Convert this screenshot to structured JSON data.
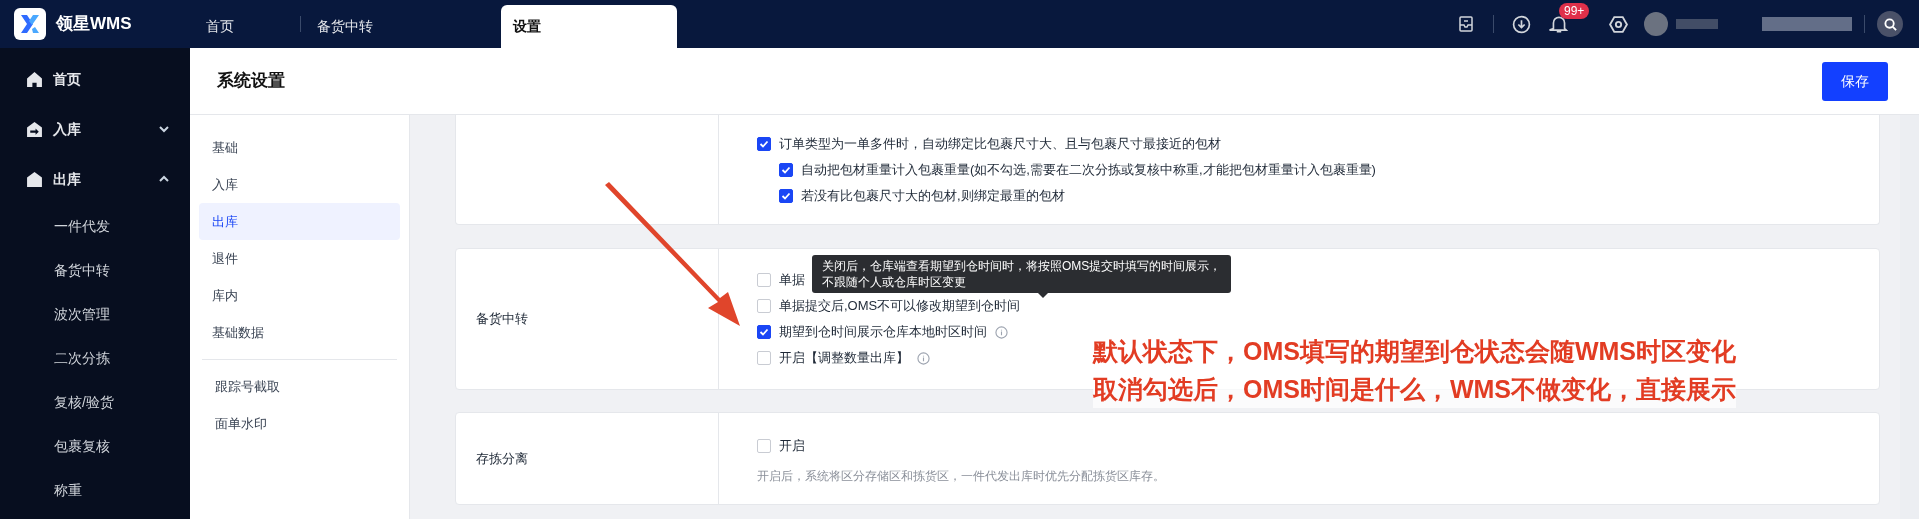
{
  "app": {
    "logo_text": "领星WMS"
  },
  "tabs": [
    {
      "label": "首页",
      "selected": false
    },
    {
      "label": "备货中转",
      "selected": false
    },
    {
      "label": "设置",
      "selected": true
    }
  ],
  "header": {
    "badge": "99+"
  },
  "sidebar": {
    "items": [
      {
        "label": "首页",
        "kind": "home"
      },
      {
        "label": "入库",
        "kind": "inbound",
        "expanded": false
      },
      {
        "label": "出库",
        "kind": "outbound",
        "expanded": true,
        "children": [
          {
            "label": "一件代发"
          },
          {
            "label": "备货中转"
          },
          {
            "label": "波次管理"
          },
          {
            "label": "二次分拣"
          },
          {
            "label": "复核/验货"
          },
          {
            "label": "包裹复核"
          },
          {
            "label": "称重"
          }
        ]
      }
    ]
  },
  "page": {
    "title": "系统设置",
    "save_button": "保存"
  },
  "settings_nav": {
    "sections": [
      {
        "items": [
          {
            "label": "基础",
            "selected": false
          },
          {
            "label": "入库",
            "selected": false
          },
          {
            "label": "出库",
            "selected": true
          },
          {
            "label": "退件",
            "selected": false
          },
          {
            "label": "库内",
            "selected": false
          },
          {
            "label": "基础数据",
            "selected": false
          }
        ]
      },
      {
        "items": [
          {
            "label": "跟踪号截取",
            "selected": false
          },
          {
            "label": "面单水印",
            "selected": false
          }
        ]
      }
    ]
  },
  "cards": [
    {
      "options": [
        {
          "label": "订单类型为一单多件时，自动绑定比包裹尺寸大、且与包裹尺寸最接近的包材",
          "checked": true,
          "info": false,
          "children": [
            {
              "label": "自动把包材重量计入包裹重量(如不勾选,需要在二次分拣或复核中称重,才能把包材重量计入包裹重量)",
              "checked": true,
              "info": false
            },
            {
              "label": "若没有比包裹尺寸大的包材,则绑定最重的包材",
              "checked": true,
              "info": false
            }
          ]
        }
      ]
    },
    {
      "label": "备货中转",
      "options": [
        {
          "label": "单据",
          "checked": false,
          "info": false
        },
        {
          "label": "单据提交后,OMS不可以修改期望到仓时间",
          "checked": false,
          "info": false
        },
        {
          "label": "期望到仓时间展示仓库本地时区时间",
          "checked": true,
          "info": true
        },
        {
          "label": "开启【调整数量出库】",
          "checked": false,
          "info": true
        }
      ],
      "tooltip": {
        "lines": [
          "关闭后，仓库端查看期望到仓时间时，将按照OMS提交时填写的时间展示，",
          "不跟随个人或仓库时区变更"
        ]
      }
    },
    {
      "label": "存拣分离",
      "options": [
        {
          "label": "开启",
          "checked": false,
          "info": false
        }
      ],
      "hint": "开启后，系统将区分存储区和拣货区，一件代发出库时优先分配拣货区库存。"
    }
  ],
  "annotation": {
    "lines": [
      "默认状态下，OMS填写的期望到仓状态会随WMS时区变化",
      "取消勾选后，OMS时间是什么，WMS不做变化，直接展示"
    ]
  }
}
